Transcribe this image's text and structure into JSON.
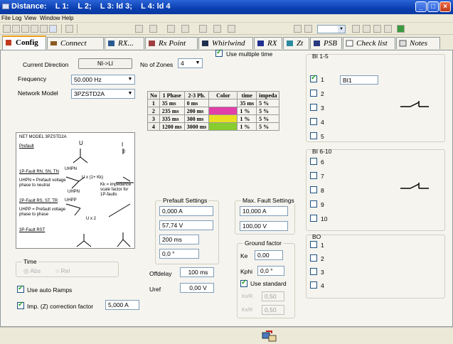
{
  "window": {
    "title": "Distance:    L 1:    L 2;    L 3: ld 3;    L 4: ld 4",
    "buttons": {
      "minimize": "_",
      "maximize": "□",
      "close": "×"
    }
  },
  "menu": [
    "File",
    "Log",
    "View",
    "Window",
    "Help"
  ],
  "toolbar": {
    "combo_value": ""
  },
  "tabs": [
    {
      "label": "Config",
      "active": true
    },
    {
      "label": "Connect",
      "active": false
    },
    {
      "label": "RX...",
      "active": false
    },
    {
      "label": "Rx Point",
      "active": false
    },
    {
      "label": "Whirlwind",
      "active": false
    },
    {
      "label": "RX",
      "active": false
    },
    {
      "label": "Zt",
      "active": false
    },
    {
      "label": "PSB",
      "active": false
    },
    {
      "label": "Check list",
      "active": false
    },
    {
      "label": "Notes",
      "active": false
    }
  ],
  "config": {
    "current_direction_label": "Current Direction",
    "current_direction_button": "NI->LI",
    "zones_label": "No of Zones",
    "zones_value": "4",
    "use_multiple_time_label": "Use multiple time",
    "use_multiple_time": true,
    "frequency_label": "Frequency",
    "frequency_value": "50.000 Hz",
    "network_model_label": "Network Model",
    "network_model_value": "3PZSTD2A"
  },
  "zone_table": {
    "headers": [
      "No",
      "1 Phase",
      "2-3 Ph.",
      "Color",
      "time",
      "impeda"
    ],
    "rows": [
      {
        "no": "1",
        "phase1": "35  ms",
        "phase23": "0  ms",
        "color": "",
        "time": "35 ms",
        "impedance": "5  %"
      },
      {
        "no": "2",
        "phase1": "235  ms",
        "phase23": "200  ms",
        "color": "#e040a8",
        "time": "1  %",
        "impedance": "5  %"
      },
      {
        "no": "3",
        "phase1": "335  ms",
        "phase23": "300  ms",
        "color": "#e8e020",
        "time": "1  %",
        "impedance": "5  %"
      },
      {
        "no": "4",
        "phase1": "1200  ms",
        "phase23": "3000  ms",
        "color": "#88cc30",
        "time": "1  %",
        "impedance": "5  %"
      }
    ]
  },
  "diagram": {
    "title": "NET MODEL 3PZSTD2A",
    "prefault": "Prefault",
    "u_label": "U",
    "i_label": "I",
    "zero_label": "0",
    "fault_1p": "1P-Fault RN, SN, TN",
    "uhpn": "UHPN",
    "uhpn_formula": "U x (1+ Kk)",
    "kk_desc": "Kk = impedance scale factor for 1P-faults",
    "uhpn_desc": "UHPN = Prefault voltage phase to neutral",
    "fault_2p": "2P-Fault RS, ST, TR",
    "uhpp": "UHPP",
    "uhpp_desc": "UHPP = Prefault voltage phase to phase",
    "ux2": "U x 2",
    "fault_3p": "3P-Fault RST"
  },
  "time_group": {
    "label": "Time",
    "opt1": "Abs",
    "opt2": "Rel"
  },
  "prefault_settings": {
    "label": "Prefault Settings",
    "current": "0,000 A",
    "voltage": "57,74 V",
    "time": "200 ms",
    "angle": "0,0 °"
  },
  "max_fault": {
    "label": "Max. Fault Settings",
    "current": "10,000 A",
    "voltage": "100,00 V"
  },
  "ground_factor": {
    "label": "Ground factor",
    "ke_label": "Ke",
    "ke_value": "0,00",
    "kphi_label": "Kphi",
    "kphi_value": "0,0 °",
    "use_standard_label": "Use standard",
    "use_standard": true,
    "kpm_label": "Kx/R",
    "kpm_value": "0,50",
    "kphi2_label": "Kx/R",
    "kphi2_value": "0,50"
  },
  "offdelay": {
    "label": "Offdelay",
    "value": "100 ms"
  },
  "uref": {
    "label": "Uref",
    "value": "0,00 V"
  },
  "use_auto_ramps": {
    "label": "Use auto Ramps",
    "checked": true
  },
  "imp_correction": {
    "label": "Imp. (Z) correction factor",
    "checked": true,
    "value": "5,000 A"
  },
  "bi_1_5": {
    "label": "BI 1-5",
    "items": [
      {
        "label": "1",
        "checked": true,
        "name": "BI1"
      },
      {
        "label": "2",
        "checked": false
      },
      {
        "label": "3",
        "checked": false
      },
      {
        "label": "4",
        "checked": false
      },
      {
        "label": "5",
        "checked": false
      }
    ]
  },
  "bi_6_10": {
    "label": "BI 6-10",
    "items": [
      {
        "label": "6",
        "checked": false
      },
      {
        "label": "7",
        "checked": false
      },
      {
        "label": "8",
        "checked": false
      },
      {
        "label": "9",
        "checked": false
      },
      {
        "label": "10",
        "checked": false
      }
    ]
  },
  "bo": {
    "label": "BO",
    "items": [
      {
        "label": "1",
        "checked": false
      },
      {
        "label": "2",
        "checked": false
      },
      {
        "label": "3",
        "checked": false
      },
      {
        "label": "4",
        "checked": false
      }
    ]
  }
}
